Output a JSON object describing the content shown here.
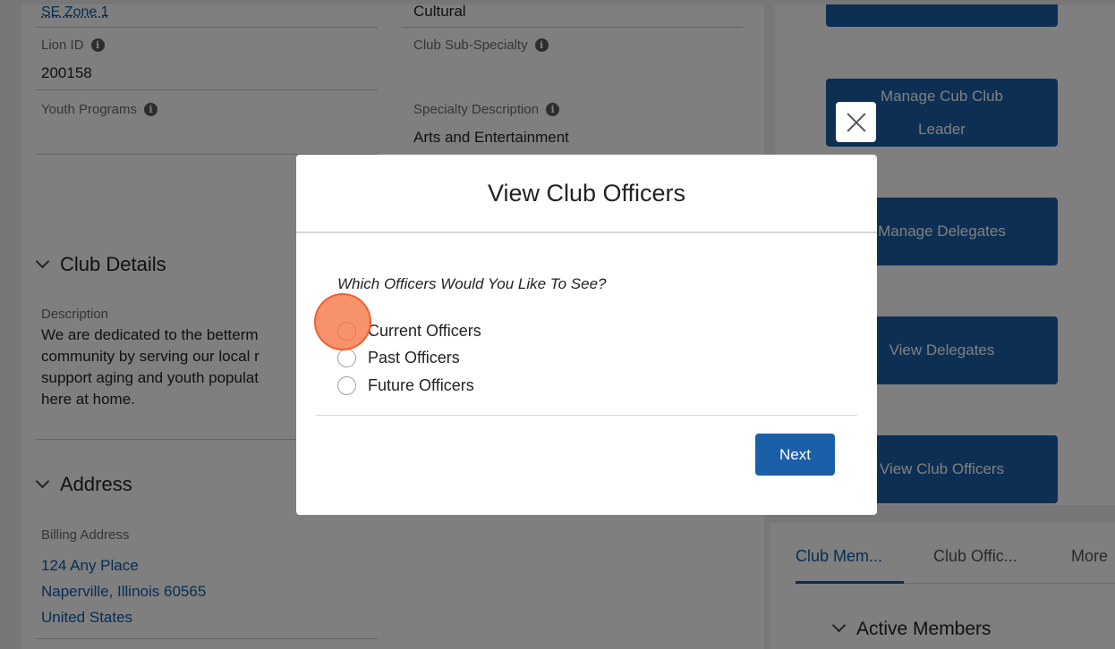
{
  "background": {
    "zone_link": "SE Zone 1",
    "specialty_value": "Cultural",
    "lion_id_label": "Lion ID",
    "lion_id_value": "200158",
    "sub_specialty_label": "Club Sub-Specialty",
    "youth_programs_label": "Youth Programs",
    "specialty_description_label": "Specialty Description",
    "specialty_description_value": "Arts and Entertainment",
    "club_details_title": "Club Details",
    "description_label": "Description",
    "description_lines": [
      "We are dedicated to the betterm",
      "community by serving our local r",
      "support aging and youth populat",
      "here at home."
    ],
    "address_title": "Address",
    "billing_address_label": "Billing Address",
    "billing_address_lines": [
      "124 Any Place",
      "Naperville, Illinois 60565",
      "United States"
    ],
    "info_glyph": "i",
    "action_buttons": [
      {
        "line1": "Manage Cub Club",
        "line2": "Leader"
      },
      {
        "label": "Manage Delegates"
      },
      {
        "label": "View Delegates"
      },
      {
        "label": "View Club Officers"
      }
    ],
    "tabs": [
      {
        "label": "Club Mem..."
      },
      {
        "label": "Club Offic..."
      },
      {
        "label": "More"
      }
    ],
    "active_members_title": "Active Members"
  },
  "modal": {
    "title": "View Club Officers",
    "question": "Which Officers Would You Like To See?",
    "options": [
      "Current Officers",
      "Past Officers",
      "Future Officers"
    ],
    "next_label": "Next"
  },
  "colors": {
    "brand_blue": "#1b5fa8",
    "link_blue": "#0b5cab",
    "click_indicator": "#f56e3c"
  }
}
